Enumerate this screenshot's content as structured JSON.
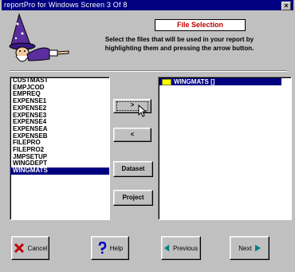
{
  "window": {
    "title": "reportPro for Windows Screen 3 Of 8",
    "close_glyph": "×"
  },
  "header": {
    "heading": "File Selection",
    "instructions_line1": "Select the files that will be used in your report by",
    "instructions_line2": "highlighting them and pressing the arrow button."
  },
  "available_files": {
    "items": [
      "CUSTMAST",
      "EMPJCOD",
      "EMPREQ",
      "EXPENSE1",
      "EXPENSE2",
      "EXPENSE3",
      "EXPENSE4",
      "EXPENSEA",
      "EXPENSEB",
      "FILEPRO",
      "FILEPRO2",
      "JMPSETUP",
      "WINGDEPT",
      "WINGMATS"
    ],
    "selected": "WINGMATS"
  },
  "selected_files": {
    "items": [
      "WINGMATS []"
    ]
  },
  "buttons": {
    "add": ">",
    "remove": "<",
    "dataset": "Dataset",
    "project": "Project",
    "cancel": "Cancel",
    "help": "Help",
    "previous": "Previous",
    "next": "Next"
  },
  "colors": {
    "titlebar": "#000080",
    "heading": "#c00000",
    "selection": "#000080"
  }
}
